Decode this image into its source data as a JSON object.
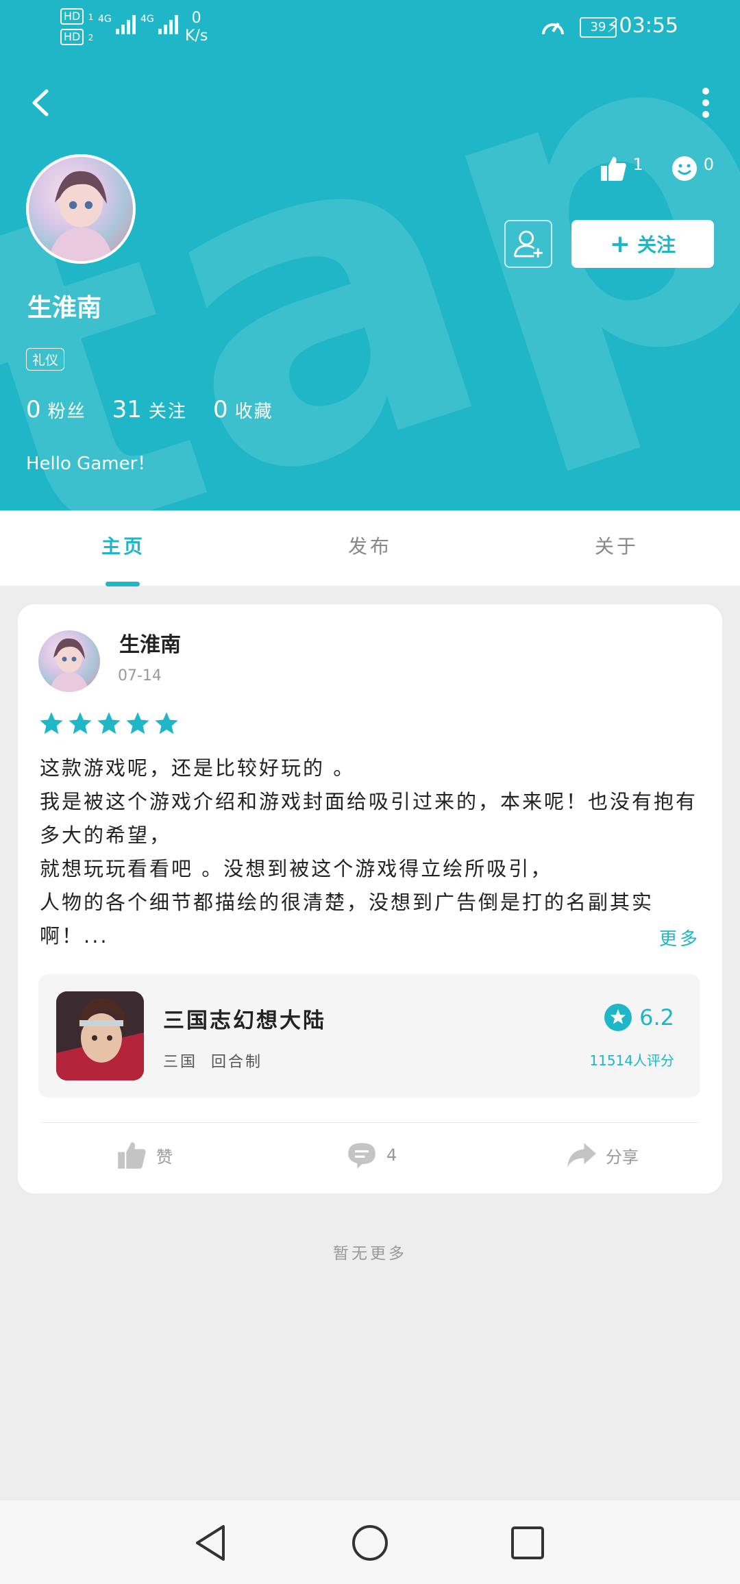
{
  "status_bar": {
    "hd1": "HD",
    "hd2": "HD",
    "sim1": "1",
    "sim2": "2",
    "net1": "4G",
    "net2": "4G",
    "speed_value": "0",
    "speed_unit": "K/s",
    "battery": "39",
    "time": "03:55"
  },
  "profile": {
    "name": "生淮南",
    "tag": "礼仪",
    "likes_count": "1",
    "emoji_count": "0",
    "follow_label": "关注",
    "stats": [
      {
        "num": "0",
        "label": "粉丝"
      },
      {
        "num": "31",
        "label": "关注"
      },
      {
        "num": "0",
        "label": "收藏"
      }
    ],
    "bio": "Hello Gamer！"
  },
  "tabs": [
    {
      "label": "主页",
      "active": true
    },
    {
      "label": "发布",
      "active": false
    },
    {
      "label": "关于",
      "active": false
    }
  ],
  "post": {
    "author": "生淮南",
    "date": "07-14",
    "stars": 5,
    "lines": [
      "这款游戏呢，还是比较好玩的 。",
      "我是被这个游戏介绍和游戏封面给吸引过来的，本来呢！也没有抱有多大的希望，",
      "就想玩玩看看吧 。没想到被这个游戏得立绘所吸引，",
      "人物的各个细节都描绘的很清楚，没想到广告倒是打的名副其实啊！..."
    ],
    "more_label": "更多",
    "game": {
      "title": "三国志幻想大陆",
      "tags": [
        "三国",
        "回合制"
      ],
      "score": "6.2",
      "rating_count": "11514人评分"
    },
    "actions": {
      "like_label": "赞",
      "comment_count": "4",
      "share_label": "分享"
    }
  },
  "footer_text": "暂无更多",
  "colors": {
    "accent": "#1fb7c7",
    "background": "#ededed"
  }
}
